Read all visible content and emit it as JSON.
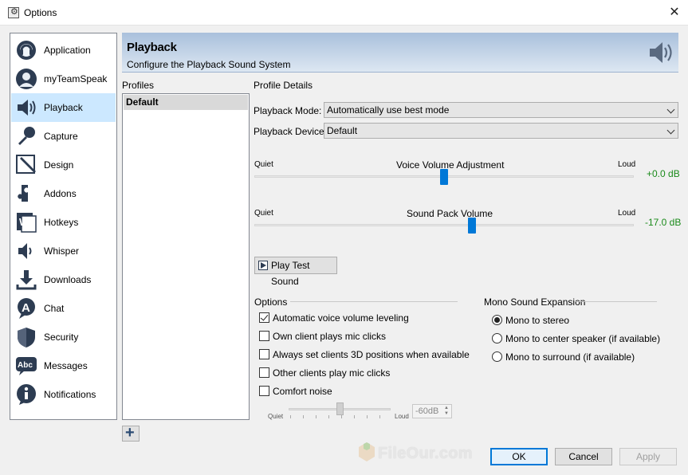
{
  "window": {
    "title": "Options"
  },
  "sidebar": {
    "items": [
      {
        "label": "Application",
        "icon": "application-icon"
      },
      {
        "label": "myTeamSpeak",
        "icon": "user-icon"
      },
      {
        "label": "Playback",
        "icon": "speaker-icon",
        "selected": true
      },
      {
        "label": "Capture",
        "icon": "microphone-icon"
      },
      {
        "label": "Design",
        "icon": "design-icon"
      },
      {
        "label": "Addons",
        "icon": "puzzle-icon"
      },
      {
        "label": "Hotkeys",
        "icon": "keyboard-icon"
      },
      {
        "label": "Whisper",
        "icon": "whisper-icon"
      },
      {
        "label": "Downloads",
        "icon": "download-icon"
      },
      {
        "label": "Chat",
        "icon": "chat-icon"
      },
      {
        "label": "Security",
        "icon": "shield-icon"
      },
      {
        "label": "Messages",
        "icon": "messages-icon"
      },
      {
        "label": "Notifications",
        "icon": "info-icon"
      }
    ]
  },
  "header": {
    "title": "Playback",
    "subtitle": "Configure the Playback Sound System"
  },
  "profiles": {
    "label": "Profiles",
    "items": [
      "Default"
    ]
  },
  "details": {
    "label": "Profile Details",
    "playback_mode_label": "Playback Mode:",
    "playback_mode_value": "Automatically use best mode",
    "playback_device_label": "Playback Device:",
    "playback_device_value": "Default",
    "voice_volume": {
      "label": "Voice Volume Adjustment",
      "quiet": "Quiet",
      "loud": "Loud",
      "value_text": "+0.0 dB",
      "position": 0.5
    },
    "sound_pack": {
      "label": "Sound Pack Volume",
      "quiet": "Quiet",
      "loud": "Loud",
      "value_text": "-17.0 dB",
      "position": 0.575
    },
    "play_test_label": "Play Test Sound"
  },
  "options": {
    "label": "Options",
    "checkboxes": [
      {
        "label": "Automatic voice volume leveling",
        "checked": true
      },
      {
        "label": "Own client plays mic clicks",
        "checked": false
      },
      {
        "label": "Always set clients 3D positions when available",
        "checked": false
      },
      {
        "label": "Other clients play mic clicks",
        "checked": false
      },
      {
        "label": "Comfort noise",
        "checked": false
      }
    ],
    "comfort": {
      "quiet": "Quiet",
      "loud": "Loud",
      "value": "-60dB",
      "position": 0.5
    }
  },
  "mono": {
    "label": "Mono Sound Expansion",
    "radios": [
      {
        "label": "Mono to stereo",
        "checked": true
      },
      {
        "label": "Mono to center speaker (if available)",
        "checked": false
      },
      {
        "label": "Mono to surround (if available)",
        "checked": false
      }
    ]
  },
  "footer": {
    "ok": "OK",
    "cancel": "Cancel",
    "apply": "Apply"
  },
  "watermark": {
    "text": "FileOur.com"
  },
  "colors": {
    "accent": "#0078d7",
    "selection": "#cce8ff",
    "db_text": "#1a8a1a",
    "banner_top": "#a9c0dc",
    "banner_bottom": "#dde7f2"
  }
}
